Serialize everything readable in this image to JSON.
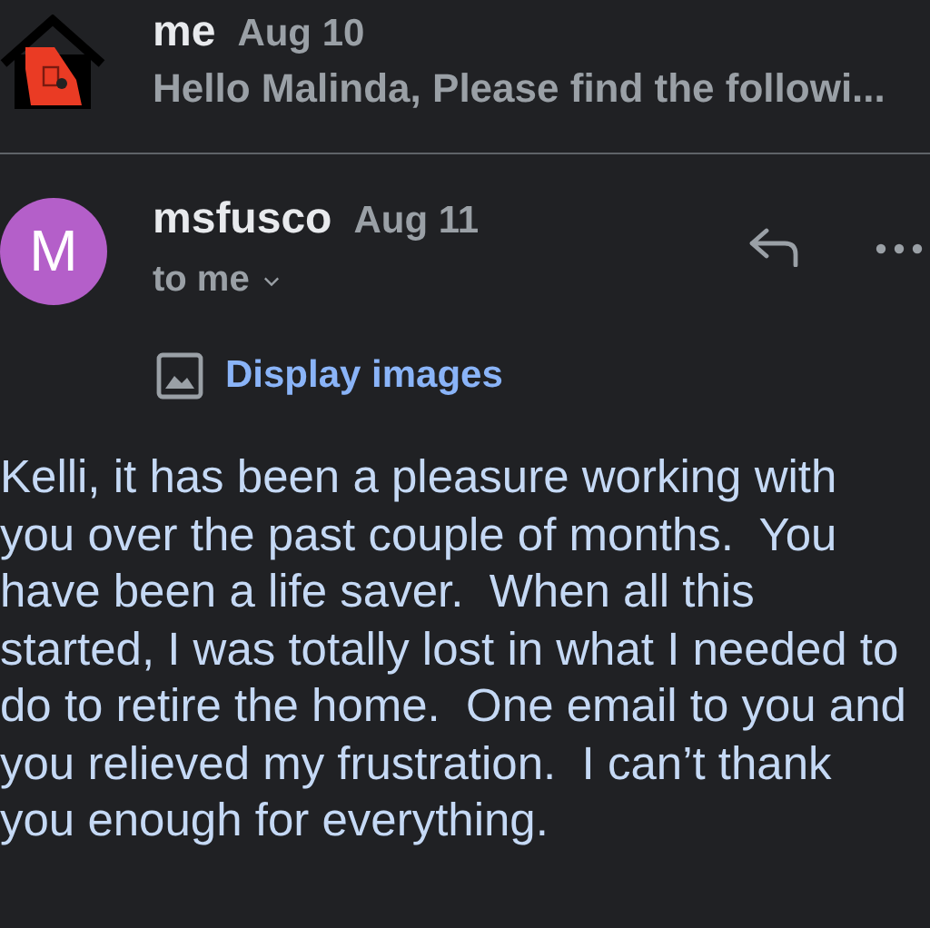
{
  "previous_message": {
    "sender": "me",
    "date": "Aug 10",
    "snippet": "Hello Malinda, Please find the followi..."
  },
  "message": {
    "avatar_letter": "M",
    "sender": "msfusco",
    "date": "Aug 11",
    "recipient": "to me",
    "display_images": "Display images",
    "body": "Kelli, it has been a pleasure working with\nyou over the past couple of months.  You\nhave been a life saver.  When all this\nstarted, I was totally lost in what I needed to\ndo to retire the home.  One email to you and\nyou relieved my frustration.  I can’t thank\nyou enough for everything."
  }
}
